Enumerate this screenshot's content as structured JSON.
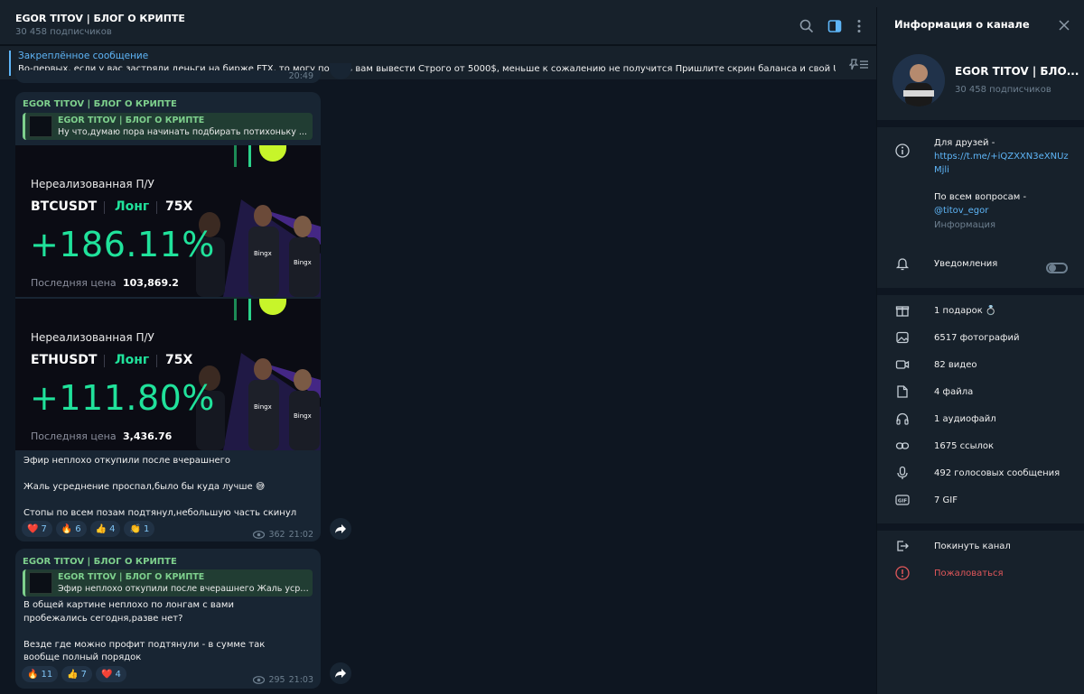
{
  "header": {
    "title": "EGOR TITOV | БЛОГ О КРИПТЕ",
    "subscribers": "30 458 подписчиков"
  },
  "pinned": {
    "label": "Закреплённое сообщение",
    "text": "Во-первых, если у вас застряли деньги на бирже FTX, то могу помочь вам вывести   Строго от 5000$, меньше к сожалению не получится   Пришлите скрин баланса и свой UID - @titov..."
  },
  "prev_time": "20:49",
  "messages": [
    {
      "author": "EGOR TITOV | БЛОГ О КРИПТЕ",
      "quote_author": "EGOR TITOV | БЛОГ О КРИПТЕ",
      "quote_text": "Ну что,думаю пора начинать подбирать потихоньку ...",
      "trades": [
        {
          "title": "Нереализованная П/У",
          "pair": "BTCUSDT",
          "direction": "Лонг",
          "leverage": "75X",
          "pnl": "+186.11%",
          "price_label": "Последняя цена",
          "price": "103,869.2"
        },
        {
          "title": "Нереализованная П/У",
          "pair": "ETHUSDT",
          "direction": "Лонг",
          "leverage": "75X",
          "pnl": "+111.80%",
          "price_label": "Последняя цена",
          "price": "3,436.76"
        }
      ],
      "text": "Эфир неплохо откупили после вчерашнего\n\nЖаль усреднение проспал,было бы куда лучше 😅\n\nСтопы по всем позам подтянул,небольшую часть скинул",
      "reactions": [
        {
          "emoji": "❤️",
          "count": "7"
        },
        {
          "emoji": "🔥",
          "count": "6"
        },
        {
          "emoji": "👍",
          "count": "4"
        },
        {
          "emoji": "👏",
          "count": "1"
        }
      ],
      "views": "362",
      "time": "21:02"
    },
    {
      "author": "EGOR TITOV | БЛОГ О КРИПТЕ",
      "quote_author": "EGOR TITOV | БЛОГ О КРИПТЕ",
      "quote_text": "Эфир неплохо откупили после вчерашнего   Жаль усре...",
      "text": "В общей картине неплохо по лонгам с вами пробежались сегодня,разве нет?\n\nВезде где можно профит подтянули - в сумме так вообще полный порядок",
      "reactions": [
        {
          "emoji": "🔥",
          "count": "11"
        },
        {
          "emoji": "👍",
          "count": "7"
        },
        {
          "emoji": "❤️",
          "count": "4"
        }
      ],
      "views": "295",
      "time": "21:03"
    }
  ],
  "panel": {
    "title": "Информация о канале",
    "channel_name": "EGOR TITOV | БЛО...",
    "subscribers": "30 458 подписчиков",
    "info_line1": "Для друзей -",
    "info_link": "https://t.me/+iQZXXN3eXNUz",
    "info_link2": "Mjli",
    "info_line2": "По всем вопросам -",
    "info_handle": "@titov_egor",
    "info_label": "Информация",
    "notifications": "Уведомления",
    "media": [
      {
        "icon": "gift-icon",
        "label": "1 подарок 💍"
      },
      {
        "icon": "photo-icon",
        "label": "6517 фотографий"
      },
      {
        "icon": "video-icon",
        "label": "82 видео"
      },
      {
        "icon": "file-icon",
        "label": "4 файла"
      },
      {
        "icon": "headphones-icon",
        "label": "1 аудиофайл"
      },
      {
        "icon": "link-icon",
        "label": "1675 ссылок"
      },
      {
        "icon": "microphone-icon",
        "label": "492 голосовых сообщения"
      },
      {
        "icon": "gif-icon",
        "label": "7 GIF"
      }
    ],
    "leave": "Покинуть канал",
    "report": "Пожаловаться"
  },
  "colors": {
    "accent": "#5eb5f7",
    "green": "#7ed08d",
    "profit": "#20e29b",
    "danger": "#e0575a"
  }
}
